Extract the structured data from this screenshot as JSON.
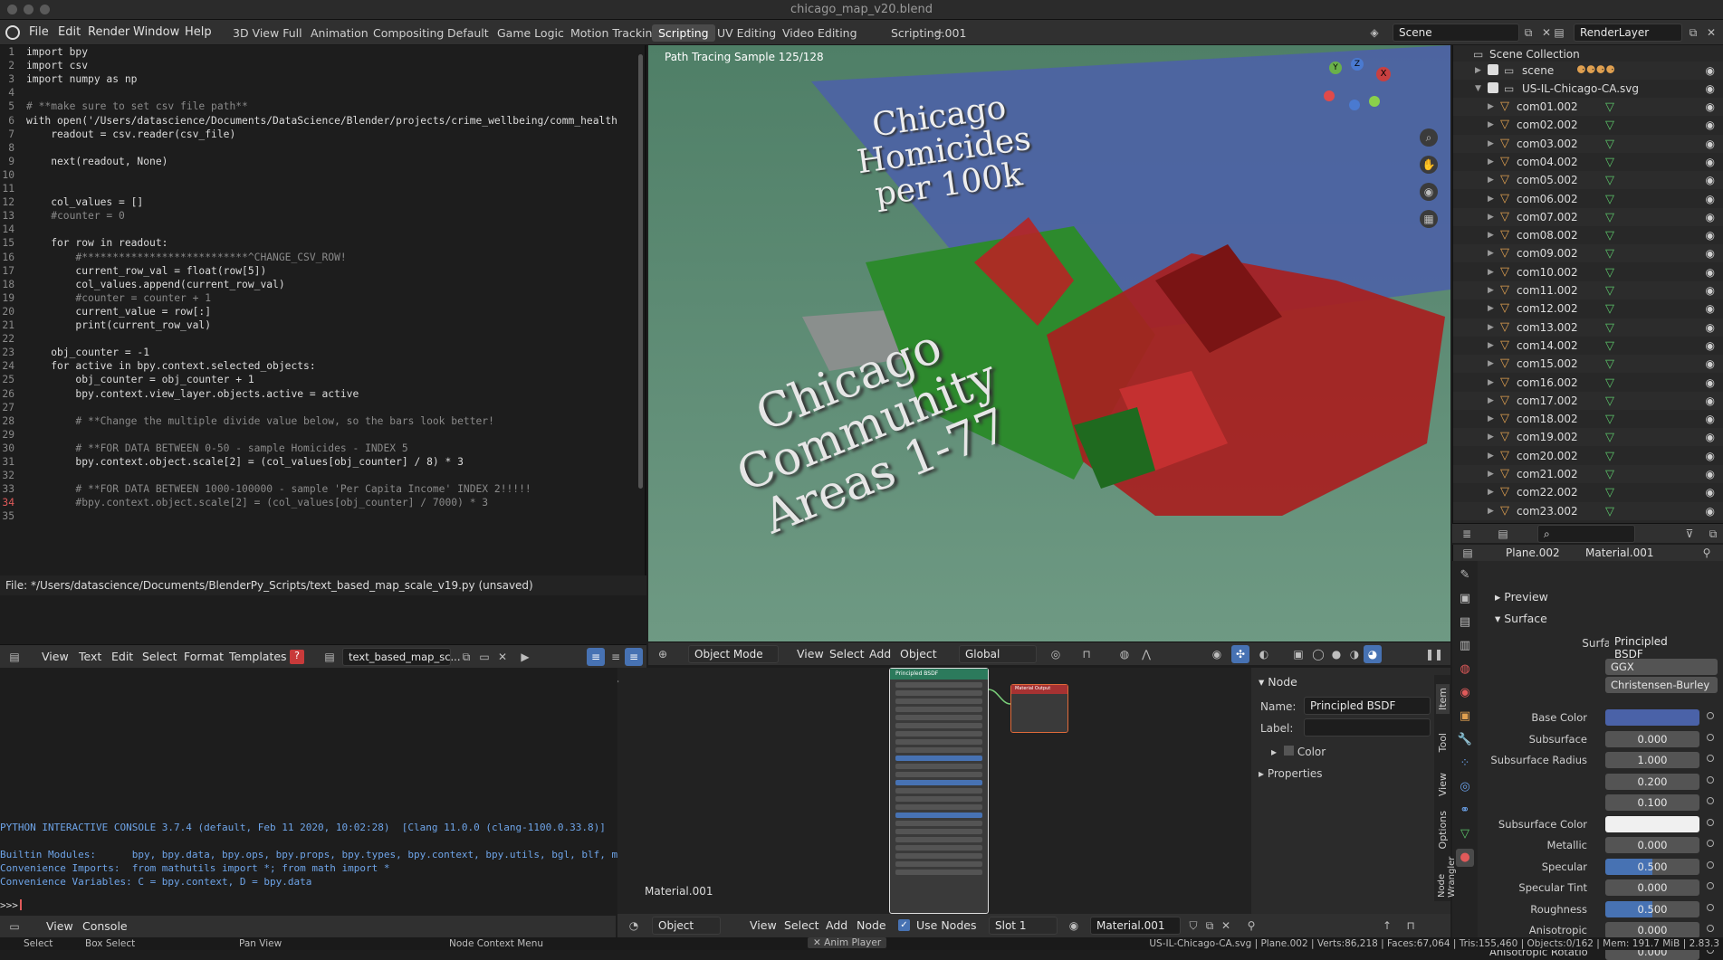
{
  "window": {
    "title": "chicago_map_v20.blend"
  },
  "menu": [
    "File",
    "Edit",
    "Render",
    "Window",
    "Help"
  ],
  "workspaces": [
    "3D View Full",
    "Animation",
    "Compositing",
    "Default",
    "Game Logic",
    "Motion Tracking",
    "Scripting",
    "UV Editing",
    "Video Editing",
    "Scripting.001"
  ],
  "active_workspace": "Scripting",
  "scene_name": "Scene",
  "render_layer": "RenderLayer",
  "code": {
    "lines": [
      "import bpy",
      "import csv",
      "import numpy as np",
      "",
      "# **make sure to set csv file path**",
      "with open('/Users/datascience/Documents/DataScience/Blender/projects/crime_wellbeing/comm_health",
      "    readout = csv.reader(csv_file)",
      "",
      "    next(readout, None)",
      "",
      "",
      "    col_values = []",
      "    #counter = 0",
      "",
      "    for row in readout:",
      "        #***************************^CHANGE_CSV_ROW!",
      "        current_row_val = float(row[5])",
      "        col_values.append(current_row_val)",
      "        #counter = counter + 1",
      "        current_value = row[:]",
      "        print(current_row_val)",
      "",
      "    obj_counter = -1",
      "    for active in bpy.context.selected_objects:",
      "        obj_counter = obj_counter + 1",
      "        bpy.context.view_layer.objects.active = active",
      "",
      "        # **Change the multiple divide value below, so the bars look better!",
      "",
      "        # **FOR DATA BETWEEN 0-50 - sample Homicides - INDEX 5",
      "        bpy.context.object.scale[2] = (col_values[obj_counter] / 8) * 3",
      "",
      "        # **FOR DATA BETWEEN 1000-100000 - sample 'Per Capita Income' INDEX 2!!!!!",
      "        #bpy.context.object.scale[2] = (col_values[obj_counter] / 7000) * 3",
      ""
    ],
    "line_numbers": [
      "1",
      "2",
      "3",
      "4",
      "5",
      "6",
      "7",
      "8",
      "9",
      "10",
      "11",
      "12",
      "13",
      "14",
      "15",
      "16",
      "17",
      "18",
      "19",
      "20",
      "21",
      "22",
      "23",
      "24",
      "25",
      "26",
      "27",
      "28",
      "29",
      "30",
      "31",
      "32",
      "33",
      "34",
      "35"
    ],
    "current_line": 34
  },
  "editor": {
    "status": "File: */Users/datascience/Documents/BlenderPy_Scripts/text_based_map_scale_v19.py (unsaved)",
    "header_menu": [
      "View",
      "Text",
      "Edit",
      "Select",
      "Format",
      "Templates"
    ],
    "text_name": "text_based_map_sc..."
  },
  "console": {
    "lines": [
      "PYTHON INTERACTIVE CONSOLE 3.7.4 (default, Feb 11 2020, 10:02:28)  [Clang 11.0.0 (clang-1100.0.33.8)]",
      "",
      "Builtin Modules:      bpy, bpy.data, bpy.ops, bpy.props, bpy.types, bpy.context, bpy.utils, bgl, blf, mathutils",
      "Convenience Imports:  from mathutils import *; from math import *",
      "Convenience Variables: C = bpy.context, D = bpy.data"
    ],
    "prompt": ">>> ",
    "header_menu": [
      "View",
      "Console"
    ]
  },
  "viewport": {
    "overlay_text": "Path Tracing Sample 125/128",
    "title_text": [
      "Chicago",
      "Homicides",
      "per 100k"
    ],
    "areas_text": [
      "Chicago",
      "Community",
      "Areas 1-77"
    ],
    "mode": "Object Mode",
    "header_menu": [
      "View",
      "Select",
      "Add",
      "Object"
    ],
    "transform": "Global",
    "gizmo_axes": [
      "X",
      "Y",
      "Z"
    ],
    "colors": {
      "floor": "#5b8a73",
      "plane": "#4a5fa0",
      "bars_red": "#b02020",
      "bars_green": "#2e8a2e"
    }
  },
  "outliner": {
    "root": "Scene Collection",
    "scene": "scene",
    "collection": "US-IL-Chicago-CA.svg",
    "items": [
      "com01.002",
      "com02.002",
      "com03.002",
      "com04.002",
      "com05.002",
      "com06.002",
      "com07.002",
      "com08.002",
      "com09.002",
      "com10.002",
      "com11.002",
      "com12.002",
      "com13.002",
      "com14.002",
      "com15.002",
      "com16.002",
      "com17.002",
      "com18.002",
      "com19.002",
      "com20.002",
      "com21.002",
      "com22.002",
      "com23.002"
    ]
  },
  "properties": {
    "object": "Plane.002",
    "material": "Material.001",
    "panel_preview": "Preview",
    "panel_surface": "Surface",
    "surface_label": "Surface",
    "surface_value": "Principled BSDF",
    "distribution": "GGX",
    "subsurface_method": "Christensen-Burley",
    "rows": [
      {
        "label": "Base Color",
        "value": "",
        "kind": "color-blue"
      },
      {
        "label": "Subsurface",
        "value": "0.000",
        "kind": "num"
      },
      {
        "label": "Subsurface Radius",
        "value": "1.000",
        "kind": "num"
      },
      {
        "label": "",
        "value": "0.200",
        "kind": "num"
      },
      {
        "label": "",
        "value": "0.100",
        "kind": "num"
      },
      {
        "label": "Subsurface Color",
        "value": "",
        "kind": "color-white"
      },
      {
        "label": "Metallic",
        "value": "0.000",
        "kind": "num"
      },
      {
        "label": "Specular",
        "value": "0.500",
        "kind": "slider"
      },
      {
        "label": "Specular Tint",
        "value": "0.000",
        "kind": "num"
      },
      {
        "label": "Roughness",
        "value": "0.500",
        "kind": "slider"
      },
      {
        "label": "Anisotropic",
        "value": "0.000",
        "kind": "num"
      },
      {
        "label": "Anisotropic Rotation",
        "value": "0.000",
        "kind": "num"
      }
    ]
  },
  "node_editor": {
    "material_label": "Material.001",
    "bsdf_title": "Principled BSDF",
    "output_title": "Material Output",
    "sidebar": {
      "title": "Node",
      "name_label": "Name:",
      "name_value": "Principled BSDF",
      "label_label": "Label:",
      "color_section": "Color",
      "properties_section": "Properties",
      "tabs": [
        "Item",
        "Tool",
        "View",
        "Options",
        "Node Wrangler"
      ]
    },
    "header": {
      "object_mode": "Object",
      "menu": [
        "View",
        "Select",
        "Add",
        "Node"
      ],
      "use_nodes": "Use Nodes",
      "slot": "Slot 1",
      "material": "Material.001"
    }
  },
  "statusbar": {
    "left": [
      "Select",
      "Box Select",
      "Pan View",
      "Node Context Menu"
    ],
    "center": "Anim Player",
    "right": "US-IL-Chicago-CA.svg | Plane.002 | Verts:86,218 | Faces:67,064 | Tris:155,460 | Objects:0/162 | Mem: 191.7 MiB | 2.83.3"
  }
}
